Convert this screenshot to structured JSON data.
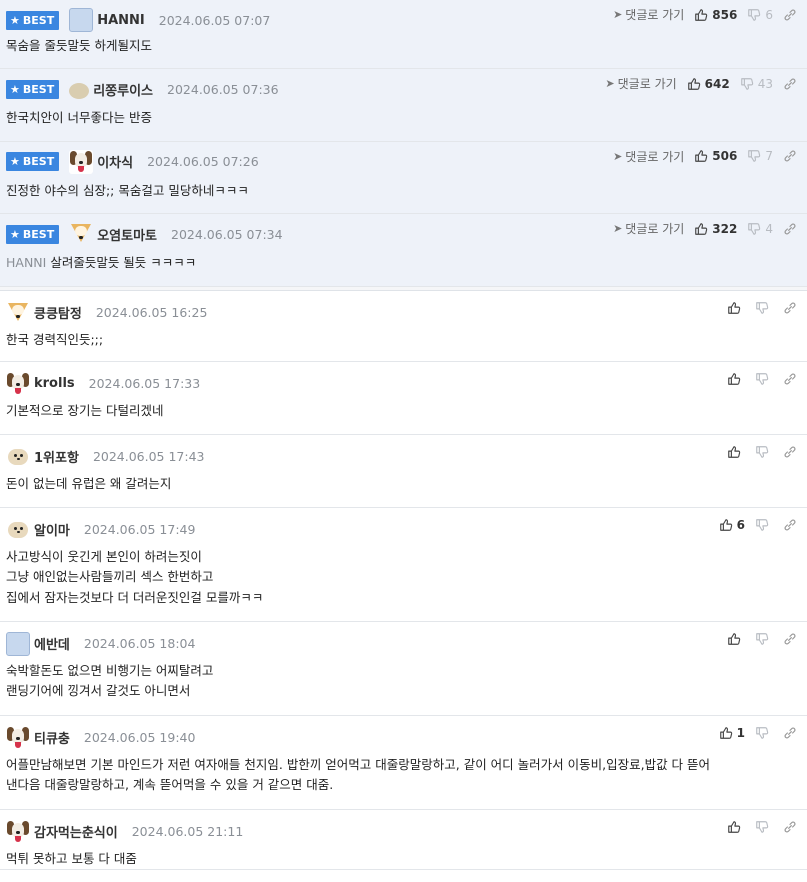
{
  "best_label": "BEST",
  "goto_label": "댓글로 가기",
  "colors": {
    "badge": "#3a86e0",
    "best_bg": "#eef2f9",
    "date": "#8a8f96"
  },
  "best_comments": [
    {
      "nick": "HANNI",
      "date": "2024.06.05 07:07",
      "avatar": "blue-avatar",
      "up": "856",
      "down": "6",
      "text": "목숨을 줄듯말듯 하게될지도",
      "quote": ""
    },
    {
      "nick": "리쫑루이스",
      "date": "2024.06.05 07:36",
      "avatar": "beige-avatar",
      "up": "642",
      "down": "43",
      "text": "한국치안이 너무좋다는 반증",
      "quote": ""
    },
    {
      "nick": "이차식",
      "date": "2024.06.05 07:26",
      "avatar": "dog-avatar",
      "up": "506",
      "down": "7",
      "text": "진정한 야수의 심장;; 목숨걸고 밀당하네ㅋㅋㅋ",
      "quote": ""
    },
    {
      "nick": "오염토마토",
      "date": "2024.06.05 07:34",
      "avatar": "fox-avatar",
      "up": "322",
      "down": "4",
      "text": "살려줄듯말듯 될듯 ㅋㅋㅋㅋ",
      "quote": "HANNI"
    }
  ],
  "comments": [
    {
      "nick": "킁킁탐정",
      "date": "2024.06.05 16:25",
      "avatar": "fox-avatar",
      "up": "",
      "lines": [
        "한국 경력직인듯;;;"
      ]
    },
    {
      "nick": "krolls",
      "date": "2024.06.05 17:33",
      "avatar": "dog-avatar",
      "up": "",
      "lines": [
        "기본적으로 장기는 다털리겠네"
      ]
    },
    {
      "nick": "1위포항",
      "date": "2024.06.05 17:43",
      "avatar": "puppy-avatar",
      "up": "",
      "lines": [
        "돈이 없는데 유럽은 왜 갈려는지"
      ]
    },
    {
      "nick": "알이마",
      "date": "2024.06.05 17:49",
      "avatar": "puppy-avatar",
      "up": "6",
      "lines": [
        "사고방식이 웃긴게 본인이 하려는짓이",
        "그냥 애인없는사람들끼리 섹스 한번하고",
        "집에서 잠자는것보다 더 더러운짓인걸 모를까ㅋㅋ"
      ]
    },
    {
      "nick": "에반데",
      "date": "2024.06.05 18:04",
      "avatar": "blue-avatar",
      "up": "",
      "lines": [
        "숙박할돈도 없으면 비행기는 어찌탈려고",
        "랜딩기어에 낑겨서 갈것도 아니면서"
      ]
    },
    {
      "nick": "티큐충",
      "date": "2024.06.05 19:40",
      "avatar": "dog-avatar",
      "up": "1",
      "lines": [
        "어플만남해보면 기본 마인드가 저런 여자애들 천지임. 밥한끼 얻어먹고 대줄랑말랑하고, 같이 어디 놀러가서 이동비,입장료,밥값 다 뜯어",
        "낸다음 대줄랑말랑하고, 계속 뜯어먹을 수 있을 거 같으면 대줌."
      ]
    },
    {
      "nick": "감자먹는춘식이",
      "date": "2024.06.05 21:11",
      "avatar": "dog-avatar",
      "up": "",
      "lines": [
        "먹튀 못하고 보통 다 대줌"
      ]
    }
  ]
}
